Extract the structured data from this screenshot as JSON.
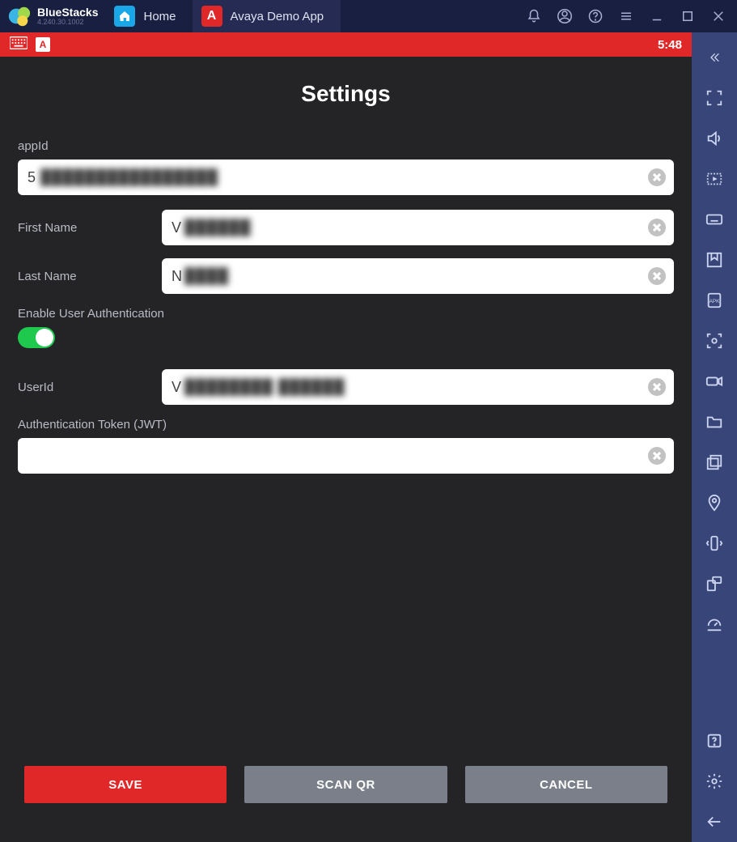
{
  "titlebar": {
    "brand": "BlueStacks",
    "version": "4.240.30.1002",
    "tabs": [
      {
        "label": "Home"
      },
      {
        "label": "Avaya Demo App",
        "icon_letter": "A"
      }
    ]
  },
  "statusbar": {
    "icon_letter": "A",
    "time": "5:48"
  },
  "settings": {
    "title": "Settings",
    "appid_label": "appId",
    "appid_prefix": "5",
    "first_name_label": "First Name",
    "first_name_prefix": "V",
    "last_name_label": "Last Name",
    "last_name_prefix": "N",
    "auth_toggle_label": "Enable User Authentication",
    "auth_toggle_on": true,
    "userid_label": "UserId",
    "userid_prefix": "V",
    "jwt_label": "Authentication Token (JWT)",
    "jwt_value": "",
    "buttons": {
      "save": "SAVE",
      "scan": "SCAN QR",
      "cancel": "CANCEL"
    }
  }
}
